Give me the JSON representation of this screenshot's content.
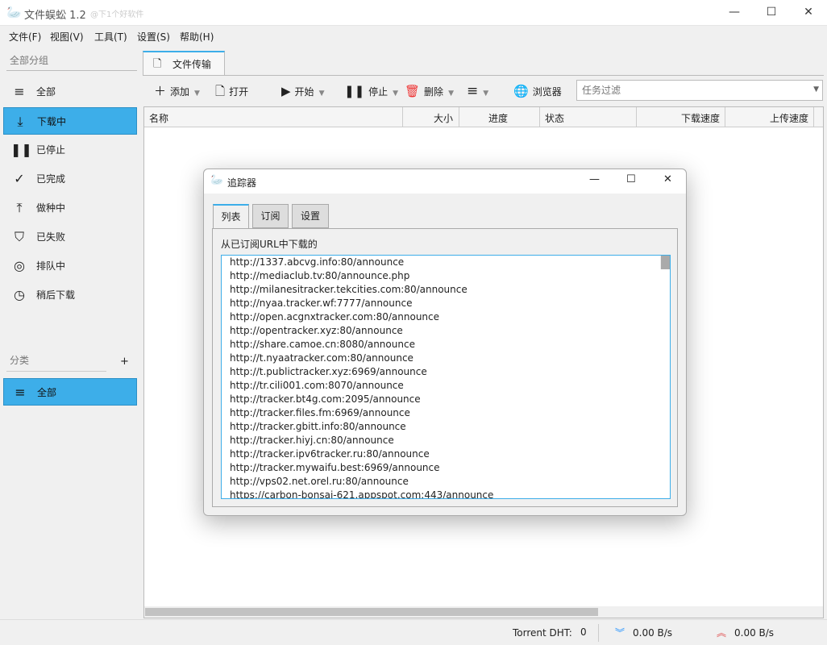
{
  "window": {
    "title": "文件蜈蚣 1.2",
    "watermark": "@下1个好软件",
    "min": "—",
    "max": "☐",
    "close": "✕"
  },
  "menu": [
    "文件(F)",
    "视图(V)",
    "工具(T)",
    "设置(S)",
    "帮助(H)"
  ],
  "sidebar": {
    "group_title": "全部分组",
    "items": [
      {
        "icon": "≡",
        "label": "全部"
      },
      {
        "icon": "⤓",
        "label": "下载中"
      },
      {
        "icon": "❚❚",
        "label": "已停止"
      },
      {
        "icon": "✓",
        "label": "已完成"
      },
      {
        "icon": "⤒",
        "label": "做种中"
      },
      {
        "icon": "⛉",
        "label": "已失败"
      },
      {
        "icon": "◎",
        "label": "排队中"
      },
      {
        "icon": "◷",
        "label": "稍后下载"
      }
    ],
    "selected": 1,
    "category_title": "分类",
    "add": "+",
    "category_items": [
      {
        "icon": "≡",
        "label": "全部"
      }
    ]
  },
  "tab": {
    "icon": "🗋",
    "label": "文件传输"
  },
  "toolbar": {
    "add": "添加",
    "open": "打开",
    "start": "开始",
    "stop": "停止",
    "delete": "删除",
    "more": "≡",
    "browser": "浏览器",
    "filter_placeholder": "任务过滤"
  },
  "columns": [
    "名称",
    "大小",
    "进度",
    "状态",
    "下载速度",
    "上传速度"
  ],
  "status": {
    "dht_label": "Torrent DHT:",
    "dht_value": "0",
    "down": "0.00 B/s",
    "up": "0.00 B/s",
    "down_color": "#1e90ff",
    "up_color": "#e05050"
  },
  "dialog": {
    "title": "追踪器",
    "tabs": [
      "列表",
      "订阅",
      "设置"
    ],
    "label": "从已订阅URL中下载的",
    "trackers": [
      "http://1337.abcvg.info:80/announce",
      "http://mediaclub.tv:80/announce.php",
      "http://milanesitracker.tekcities.com:80/announce",
      "http://nyaa.tracker.wf:7777/announce",
      "http://open.acgnxtracker.com:80/announce",
      "http://opentracker.xyz:80/announce",
      "http://share.camoe.cn:8080/announce",
      "http://t.nyaatracker.com:80/announce",
      "http://t.publictracker.xyz:6969/announce",
      "http://tr.cili001.com:8070/announce",
      "http://tracker.bt4g.com:2095/announce",
      "http://tracker.files.fm:6969/announce",
      "http://tracker.gbitt.info:80/announce",
      "http://tracker.hiyj.cn:80/announce",
      "http://tracker.ipv6tracker.ru:80/announce",
      "http://tracker.mywaifu.best:6969/announce",
      "http://vps02.net.orel.ru:80/announce",
      "https://carbon-bonsai-621.appspot.com:443/announce"
    ]
  },
  "accent": "#3daee9"
}
